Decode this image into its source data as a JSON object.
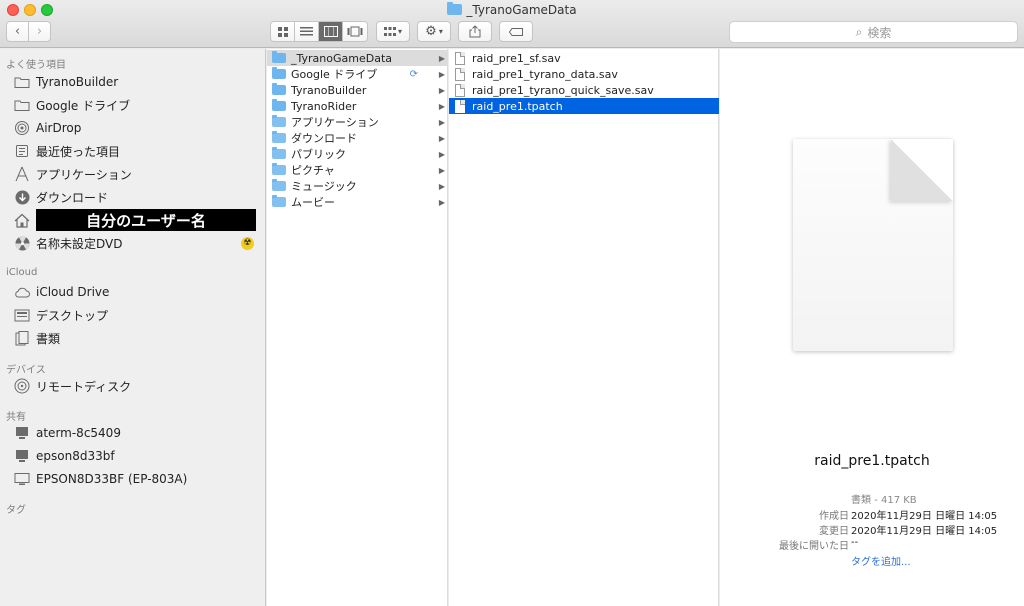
{
  "window": {
    "title": "_TyranoGameData"
  },
  "toolbar": {
    "back_label": "‹",
    "forward_label": "›",
    "view_modes": [
      "icons",
      "list",
      "columns",
      "gallery"
    ],
    "search_placeholder": "検索"
  },
  "sidebar": {
    "sections": {
      "favorites": "よく使う項目",
      "icloud": "iCloud",
      "devices": "デバイス",
      "shared": "共有",
      "tags": "タグ"
    },
    "favorites": [
      {
        "label": "TyranoBuilder",
        "icon": "folder-icon"
      },
      {
        "label": "Google ドライブ",
        "icon": "folder-icon"
      },
      {
        "label": "AirDrop",
        "icon": "airdrop-icon"
      },
      {
        "label": "最近使った項目",
        "icon": "recents-icon"
      },
      {
        "label": "アプリケーション",
        "icon": "applications-icon"
      },
      {
        "label": "ダウンロード",
        "icon": "downloads-icon"
      },
      {
        "label": "自分のユーザー名",
        "icon": "home-icon"
      },
      {
        "label": "名称未設定DVD",
        "icon": "disc-icon"
      }
    ],
    "icloud": [
      {
        "label": "iCloud Drive",
        "icon": "cloud-icon"
      },
      {
        "label": "デスクトップ",
        "icon": "desktop-icon"
      },
      {
        "label": "書類",
        "icon": "documents-icon"
      }
    ],
    "devices": [
      {
        "label": "リモートディスク",
        "icon": "remote-disc-icon"
      }
    ],
    "shared": [
      {
        "label": "aterm-8c5409",
        "icon": "computer-icon"
      },
      {
        "label": "epson8d33bf",
        "icon": "computer-icon"
      },
      {
        "label": "EPSON8D33BF (EP-803A)",
        "icon": "display-icon"
      }
    ]
  },
  "column1": [
    {
      "label": "_TyranoGameData",
      "selected": true
    },
    {
      "label": "Google ドライブ"
    },
    {
      "label": "TyranoBuilder"
    },
    {
      "label": "TyranoRider"
    },
    {
      "label": "アプリケーション"
    },
    {
      "label": "ダウンロード"
    },
    {
      "label": "パブリック"
    },
    {
      "label": "ピクチャ"
    },
    {
      "label": "ミュージック"
    },
    {
      "label": "ムービー"
    }
  ],
  "column2": [
    {
      "label": "raid_pre1_sf.sav"
    },
    {
      "label": "raid_pre1_tyrano_data.sav"
    },
    {
      "label": "raid_pre1_tyrano_quick_save.sav"
    },
    {
      "label": "raid_pre1.tpatch",
      "selected": true
    }
  ],
  "preview": {
    "filename": "raid_pre1.tpatch",
    "kind": "書類 - 417 KB",
    "created_label": "作成日",
    "created_value": "2020年11月29日 日曜日 14:05",
    "modified_label": "変更日",
    "modified_value": "2020年11月29日 日曜日 14:05",
    "opened_label": "最後に開いた日",
    "opened_value": "--",
    "add_tags": "タグを追加..."
  },
  "colors": {
    "selection_blue": "#0063e1",
    "folder_blue": "#6fb6ee",
    "link_blue": "#2f6fd6"
  }
}
